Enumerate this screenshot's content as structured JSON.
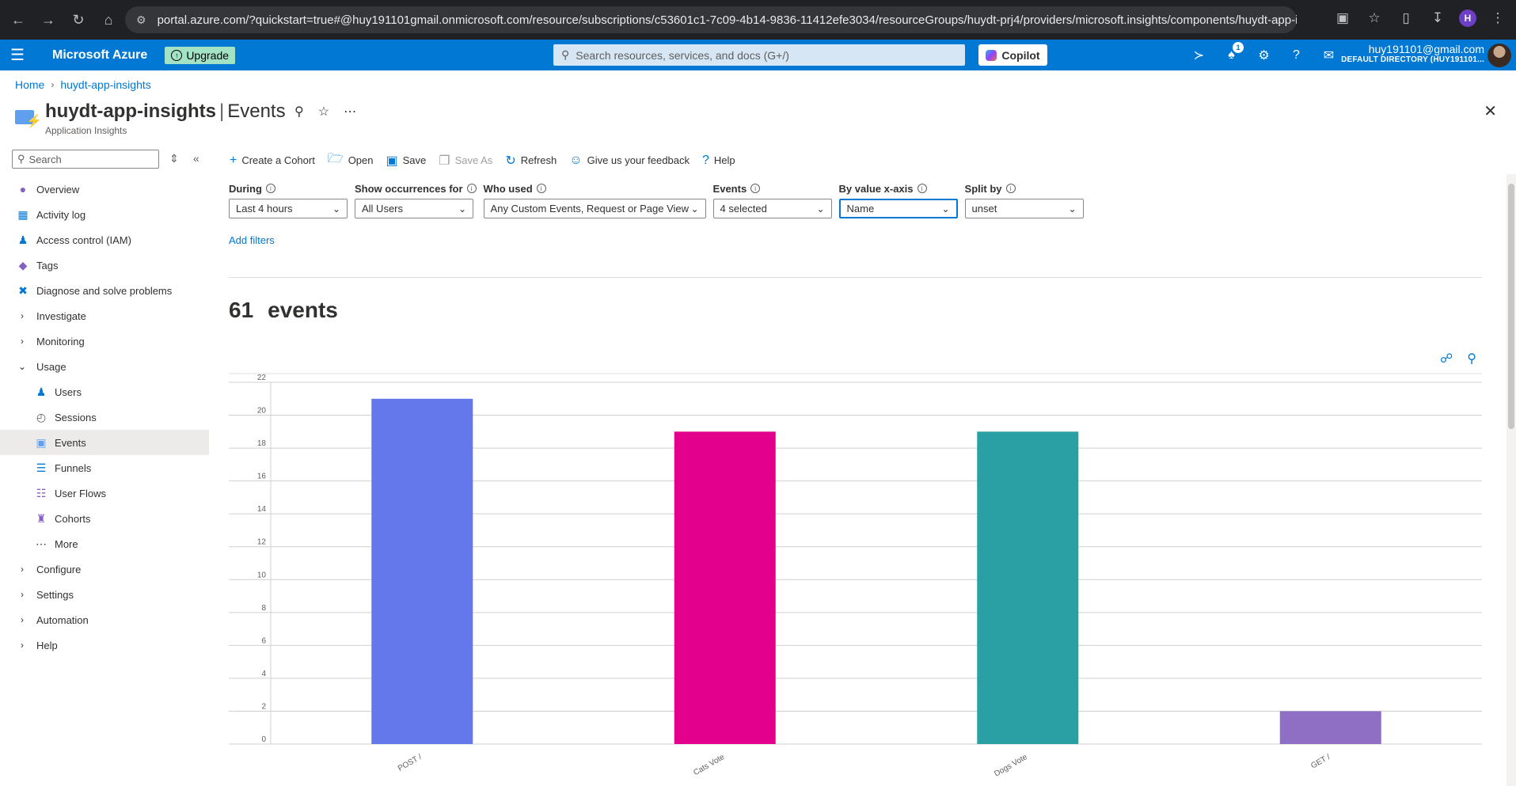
{
  "browser": {
    "url": "portal.azure.com/?quickstart=true#@huy191101gmail.onmicrosoft.com/resource/subscriptions/c53601c1-7c09-4b14-9836-11412efe3034/resourceGroups/huydt-prj4/providers/microsoft.insights/components/huydt-app-insights/ev...",
    "profile_initial": "H"
  },
  "azure": {
    "brand": "Microsoft Azure",
    "upgrade_label": "Upgrade",
    "search_placeholder": "Search resources, services, and docs (G+/)",
    "copilot_label": "Copilot",
    "notification_count": "1",
    "account_email": "huy191101@gmail.com",
    "account_directory": "DEFAULT DIRECTORY (HUY191101..."
  },
  "breadcrumb": {
    "home": "Home",
    "resource": "huydt-app-insights"
  },
  "header": {
    "resource_name": "huydt-app-insights",
    "separator": "|",
    "page": "Events",
    "subtitle": "Application Insights"
  },
  "sidebar": {
    "search_placeholder": "Search",
    "items": [
      {
        "label": "Overview",
        "icon": "bulb-icon",
        "color": "#8661c5"
      },
      {
        "label": "Activity log",
        "icon": "log-icon",
        "color": "#0078d4"
      },
      {
        "label": "Access control (IAM)",
        "icon": "people-icon",
        "color": "#0078d4"
      },
      {
        "label": "Tags",
        "icon": "tag-icon",
        "color": "#8661c5"
      },
      {
        "label": "Diagnose and solve problems",
        "icon": "wrench-icon",
        "color": "#0078d4"
      },
      {
        "label": "Investigate"
      },
      {
        "label": "Monitoring"
      },
      {
        "label": "Usage"
      },
      {
        "label": "Users"
      },
      {
        "label": "Sessions"
      },
      {
        "label": "Events"
      },
      {
        "label": "Funnels"
      },
      {
        "label": "User Flows"
      },
      {
        "label": "Cohorts"
      },
      {
        "label": "More"
      },
      {
        "label": "Configure"
      },
      {
        "label": "Settings"
      },
      {
        "label": "Automation"
      },
      {
        "label": "Help"
      }
    ]
  },
  "toolbar": {
    "create_cohort": "Create a Cohort",
    "open": "Open",
    "save": "Save",
    "save_as": "Save As",
    "refresh": "Refresh",
    "feedback": "Give us your feedback",
    "help": "Help"
  },
  "filters": {
    "during": {
      "label": "During",
      "value": "Last 4 hours"
    },
    "occurrences": {
      "label": "Show occurrences for",
      "value": "All Users"
    },
    "who_used": {
      "label": "Who used",
      "value": "Any Custom Events, Request or Page View"
    },
    "events": {
      "label": "Events",
      "value": "4 selected"
    },
    "by_value": {
      "label": "By value x-axis",
      "value": "Name"
    },
    "split_by": {
      "label": "Split by",
      "value": "unset"
    },
    "add_filters": "Add filters"
  },
  "summary": {
    "count": "61",
    "unit": "events"
  },
  "chart_data": {
    "type": "bar",
    "categories": [
      "POST /",
      "Cats Vote",
      "Dogs Vote",
      "GET /"
    ],
    "values": [
      21,
      19,
      19,
      2
    ],
    "colors": [
      "#6478ec",
      "#e3008c",
      "#2aa0a4",
      "#8f6fc4"
    ],
    "ylim": [
      0,
      22
    ],
    "yticks": [
      0,
      2,
      4,
      6,
      8,
      10,
      12,
      14,
      16,
      18,
      20,
      22
    ],
    "grid": true
  }
}
